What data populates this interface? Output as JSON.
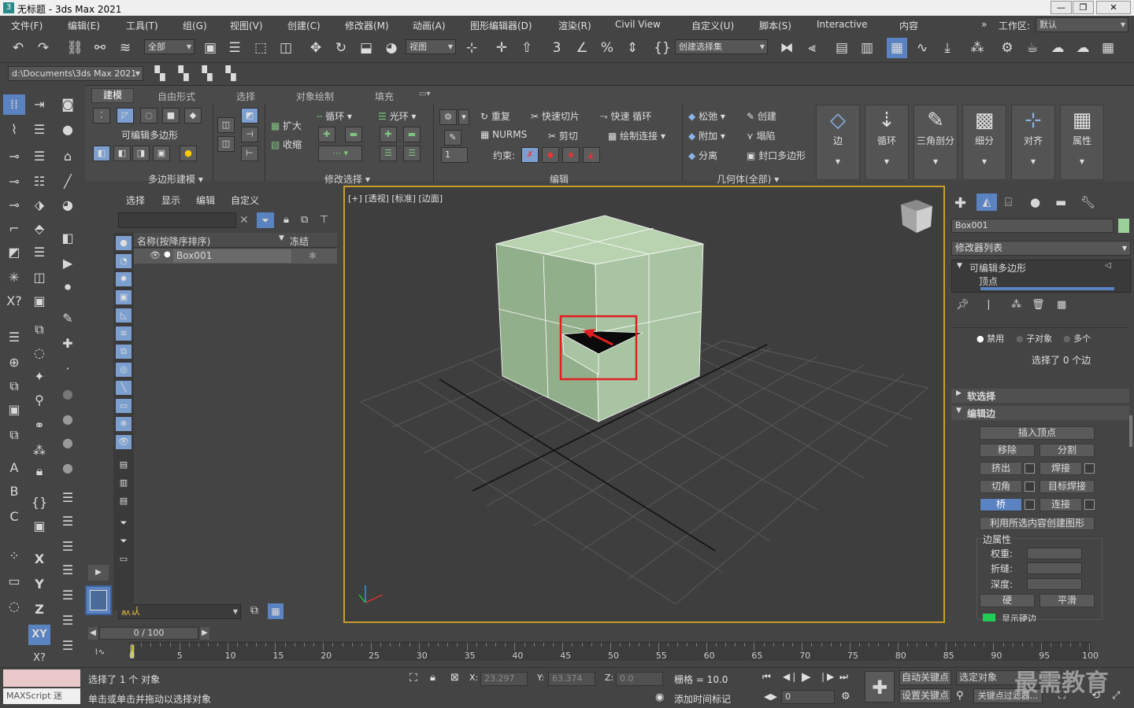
{
  "titlebar": {
    "title": "无标题 - 3ds Max 2021",
    "min": "—",
    "max": "❐",
    "close": "✕"
  },
  "menubar": {
    "items": [
      "文件(F)",
      "编辑(E)",
      "工具(T)",
      "组(G)",
      "视图(V)",
      "创建(C)",
      "修改器(M)",
      "动画(A)",
      "图形编辑器(D)",
      "渲染(R)",
      "Civil View",
      "自定义(U)",
      "脚本(S)",
      "Interactive",
      "内容"
    ],
    "workspace_label": "工作区:",
    "workspace_value": "默认"
  },
  "toolbar1": {
    "filter_dropdown": "全部",
    "ref_coord_dropdown": "视图",
    "selection_set_dropdown": "创建选择集"
  },
  "toolbar2": {
    "project_path": "d:\\Documents\\3ds Max 2021"
  },
  "ribbon": {
    "tabs": [
      "建模",
      "自由形式",
      "选择",
      "对象绘制",
      "填充"
    ],
    "poly_modeling_label": "可编辑多边形",
    "group_poly": "多边形建模",
    "btn_grow": "扩大",
    "btn_shrink": "收缩",
    "btn_loop": "循环",
    "btn_ring": "光环",
    "group_modify_sel": "修改选择",
    "btn_repeat": "重复",
    "btn_quickslice": "快速切片",
    "btn_swiftloop": "快速 循环",
    "btn_nurms": "NURMS",
    "btn_cut": "剪切",
    "btn_paintconnect": "绘制连接",
    "constraint_label": "约束:",
    "spinner_value": "1",
    "group_edit": "编辑",
    "btn_relax": "松弛",
    "btn_create": "创建",
    "btn_attach": "附加",
    "btn_collapse": "塌陷",
    "btn_detach": "分离",
    "btn_cap": "封口多边形",
    "group_geometry": "几何体(全部)",
    "big_edge": "边",
    "big_loops": "循环",
    "big_tris": "三角剖分",
    "big_subdiv": "细分",
    "big_align": "对齐",
    "big_props": "属性"
  },
  "scene_explorer": {
    "tabs": [
      "选择",
      "显示",
      "编辑",
      "自定义"
    ],
    "col_name": "名称(按降序排序)",
    "col_frozen": "冻结",
    "object": "Box001",
    "layer_dropdown": "默认"
  },
  "viewport": {
    "label": "[+] [透视] [标准] [边面]"
  },
  "command_panel": {
    "object_name": "Box001",
    "modifier_list": "修改器列表",
    "stack_item": "可编辑多边形",
    "stack_sub": "顶点",
    "radio_disable": "禁用",
    "radio_subobj": "子对象",
    "radio_multi": "多个",
    "selected_info": "选择了 0 个边",
    "rollout_soft": "软选择",
    "rollout_edit_edges": "编辑边",
    "btn_insert_vertex": "插入顶点",
    "btn_remove": "移除",
    "btn_split": "分割",
    "btn_extrude": "挤出",
    "btn_weld": "焊接",
    "btn_chamfer": "切角",
    "btn_target_weld": "目标焊接",
    "btn_bridge": "桥",
    "btn_connect": "连接",
    "btn_create_shape": "利用所选内容创建图形",
    "edge_props": "边属性",
    "weight": "权重:",
    "crease": "折缝:",
    "depth": "深度:",
    "btn_hard": "硬",
    "btn_smooth": "平滑",
    "show_hard": "显示硬边"
  },
  "timeline": {
    "frame_counter": "0 / 100",
    "ticks": [
      "0",
      "5",
      "10",
      "15",
      "20",
      "25",
      "30",
      "35",
      "40",
      "45",
      "50",
      "55",
      "60",
      "65",
      "70",
      "75",
      "80",
      "85",
      "90",
      "95",
      "100"
    ]
  },
  "statusbar": {
    "maxscript": "MAXScript 迷",
    "selected": "选择了 1 个 对象",
    "prompt": "单击或单击并拖动以选择对象",
    "x_label": "X:",
    "x_value": "23.297",
    "y_label": "Y:",
    "y_value": "63.374",
    "z_label": "Z:",
    "z_value": "0.0",
    "grid": "栅格 = 10.0",
    "add_time_tag": "添加时间标记",
    "autokey": "自动关键点",
    "selected_obj": "选定对象",
    "setkey": "设置关键点",
    "key_filters": "关键点过滤器...",
    "frame_field": "0",
    "watermark": "最需教育"
  },
  "colors": {
    "viewport_border": "#c99e27",
    "box_face": "#a8c4a2",
    "highlight_rect": "#e02020",
    "active_blue": "#5b82c1"
  }
}
